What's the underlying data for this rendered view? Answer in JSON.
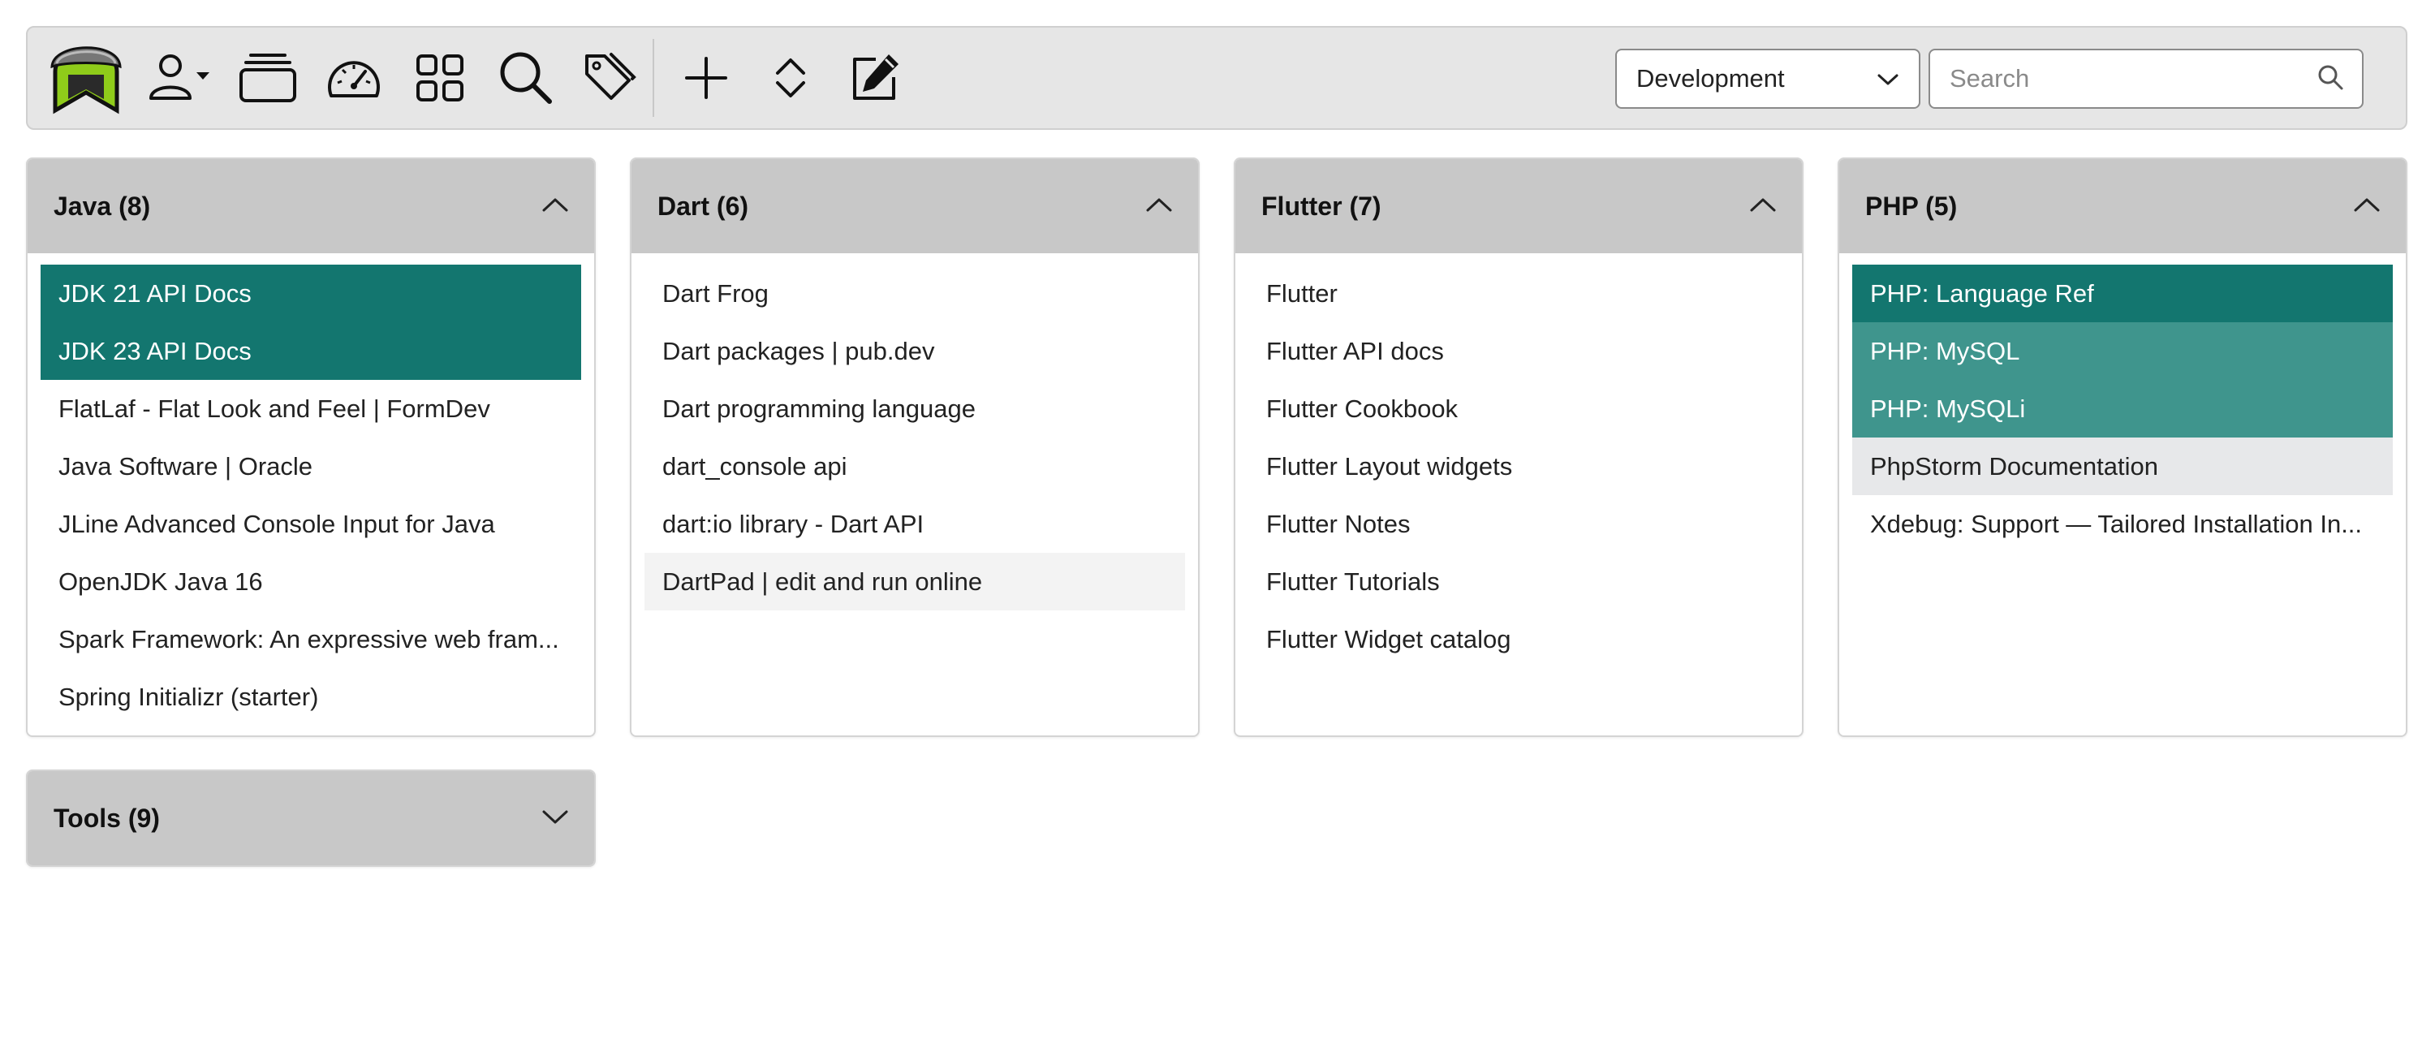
{
  "toolbar": {
    "icons": [
      {
        "name": "app-logo-icon"
      },
      {
        "name": "user-menu-icon"
      },
      {
        "name": "collections-icon"
      },
      {
        "name": "dashboard-icon"
      },
      {
        "name": "grid-view-icon"
      },
      {
        "name": "search-icon"
      },
      {
        "name": "tags-icon"
      },
      {
        "name": "add-icon"
      },
      {
        "name": "expand-collapse-icon"
      },
      {
        "name": "edit-icon"
      }
    ],
    "profile_select": {
      "value": "Development"
    },
    "search": {
      "placeholder": "Search",
      "value": ""
    }
  },
  "groups": [
    {
      "title": "Java (8)",
      "expanded": true,
      "items": [
        {
          "label": "JDK 21 API Docs",
          "state": "selected"
        },
        {
          "label": "JDK 23 API Docs",
          "state": "selected"
        },
        {
          "label": "FlatLaf - Flat Look and Feel | FormDev",
          "state": "normal"
        },
        {
          "label": "Java Software | Oracle",
          "state": "normal"
        },
        {
          "label": "JLine Advanced Console Input for Java",
          "state": "normal"
        },
        {
          "label": "OpenJDK Java 16",
          "state": "normal"
        },
        {
          "label": "Spark Framework: An expressive web fram...",
          "state": "normal"
        },
        {
          "label": "Spring Initializr (starter)",
          "state": "normal"
        }
      ]
    },
    {
      "title": "Dart (6)",
      "expanded": true,
      "items": [
        {
          "label": "Dart Frog",
          "state": "normal"
        },
        {
          "label": "Dart packages | pub.dev",
          "state": "normal"
        },
        {
          "label": "Dart programming language",
          "state": "normal"
        },
        {
          "label": "dart_console api",
          "state": "normal"
        },
        {
          "label": "dart:io library - Dart API",
          "state": "normal"
        },
        {
          "label": "DartPad | edit and run online",
          "state": "hover-light"
        }
      ]
    },
    {
      "title": "Flutter (7)",
      "expanded": true,
      "items": [
        {
          "label": "Flutter",
          "state": "normal"
        },
        {
          "label": "Flutter API docs",
          "state": "normal"
        },
        {
          "label": "Flutter Cookbook",
          "state": "normal"
        },
        {
          "label": "Flutter Layout widgets",
          "state": "normal"
        },
        {
          "label": "Flutter Notes",
          "state": "normal"
        },
        {
          "label": "Flutter Tutorials",
          "state": "normal"
        },
        {
          "label": "Flutter Widget catalog",
          "state": "normal"
        }
      ]
    },
    {
      "title": "PHP (5)",
      "expanded": true,
      "items": [
        {
          "label": "PHP: Language Ref",
          "state": "selected"
        },
        {
          "label": "PHP: MySQL",
          "state": "selected-light"
        },
        {
          "label": "PHP: MySQLi",
          "state": "selected-light"
        },
        {
          "label": "PhpStorm Documentation",
          "state": "hover"
        },
        {
          "label": "Xdebug: Support — Tailored Installation In...",
          "state": "normal"
        }
      ]
    },
    {
      "title": "Tools (9)",
      "expanded": false,
      "items": []
    }
  ],
  "colors": {
    "selected": "#13766f",
    "selected_light": "#3f958d",
    "header_bg": "#c8c8c8",
    "toolbar_bg": "#e6e6e6"
  }
}
